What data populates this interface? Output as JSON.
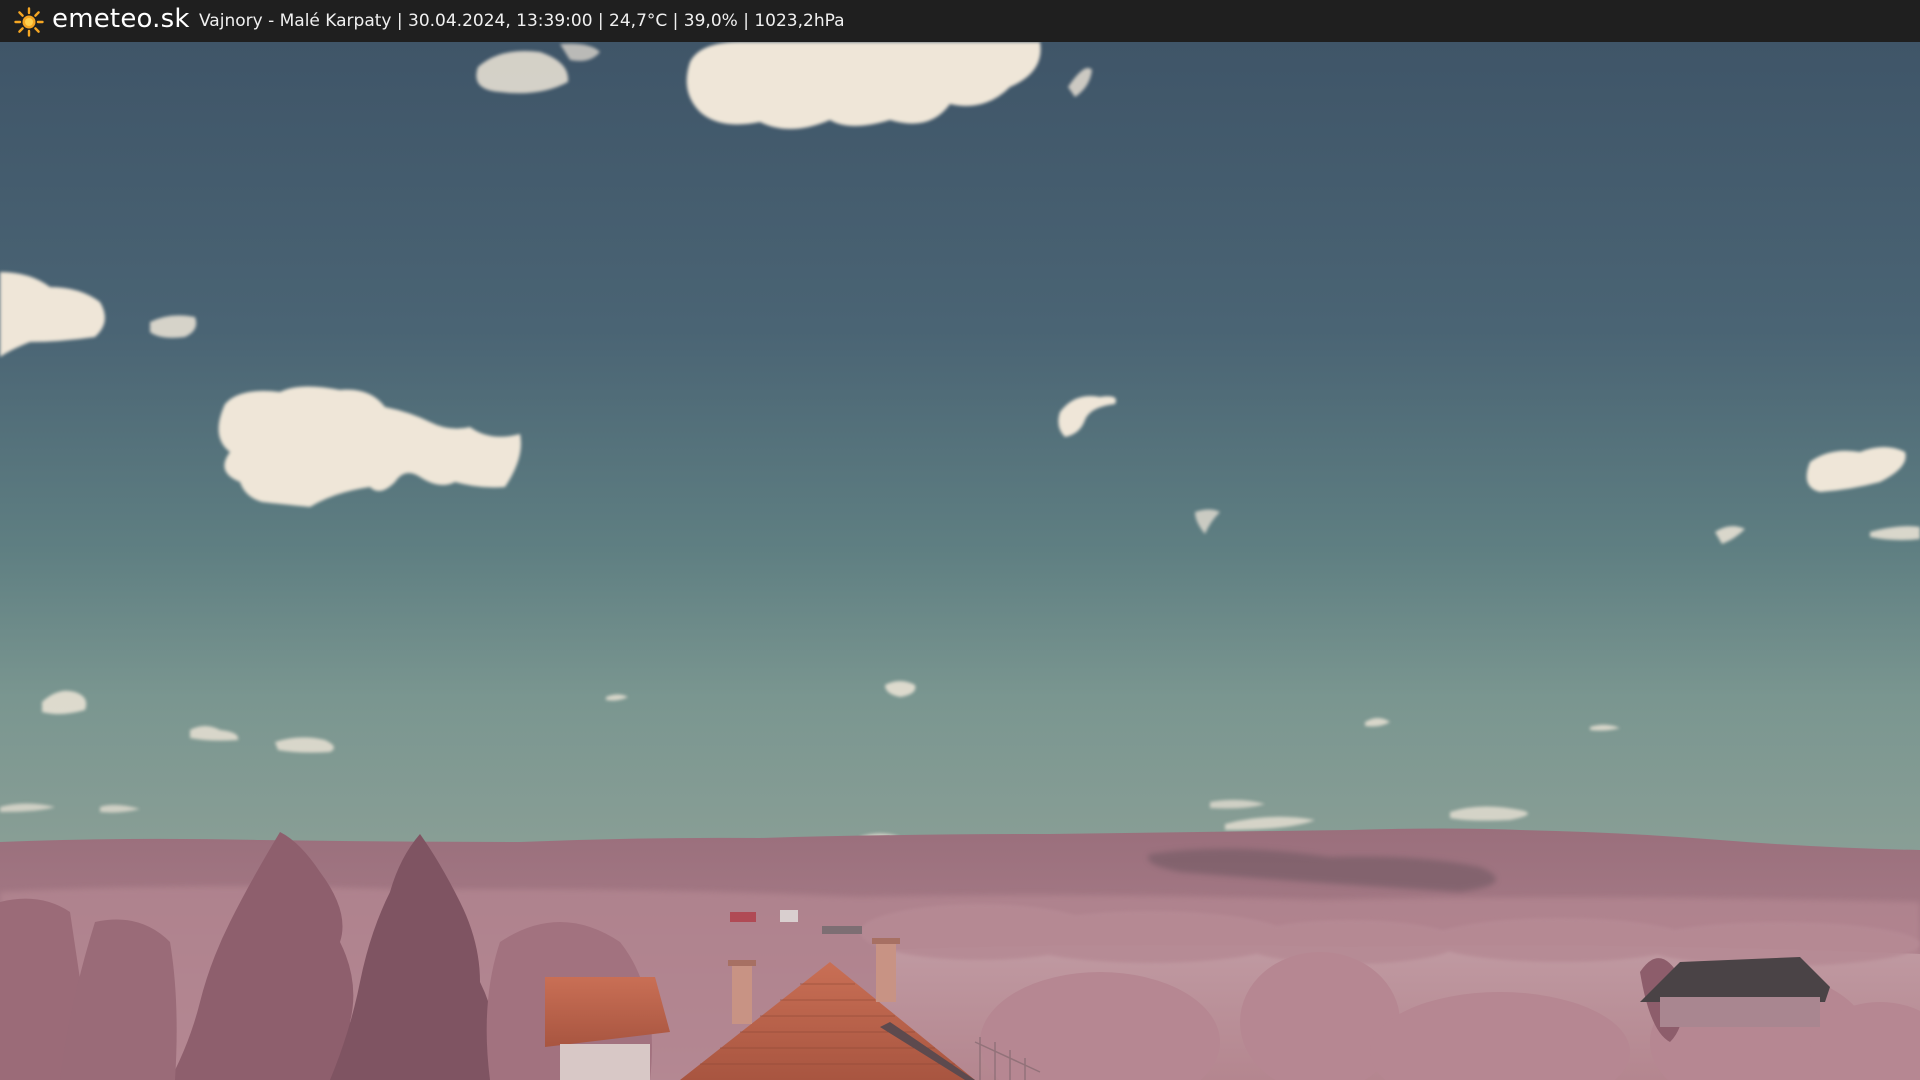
{
  "header": {
    "brand": "emeteo.sk",
    "caption": "Vajnory - Malé Karpaty | 30.04.2024, 13:39:00 | 24,7°C | 39,0% | 1023,2hPa",
    "logo_icon": "sun-icon",
    "colors": {
      "bar": "#1f1f1f",
      "sun": "#f5a623"
    }
  },
  "scene": {
    "description_colors": {
      "sky_top": "#41576a",
      "sky_horizon": "#6f8f8c",
      "hills": "#a47883",
      "vegetation": "#b48691",
      "roof": "#c2654e"
    }
  }
}
